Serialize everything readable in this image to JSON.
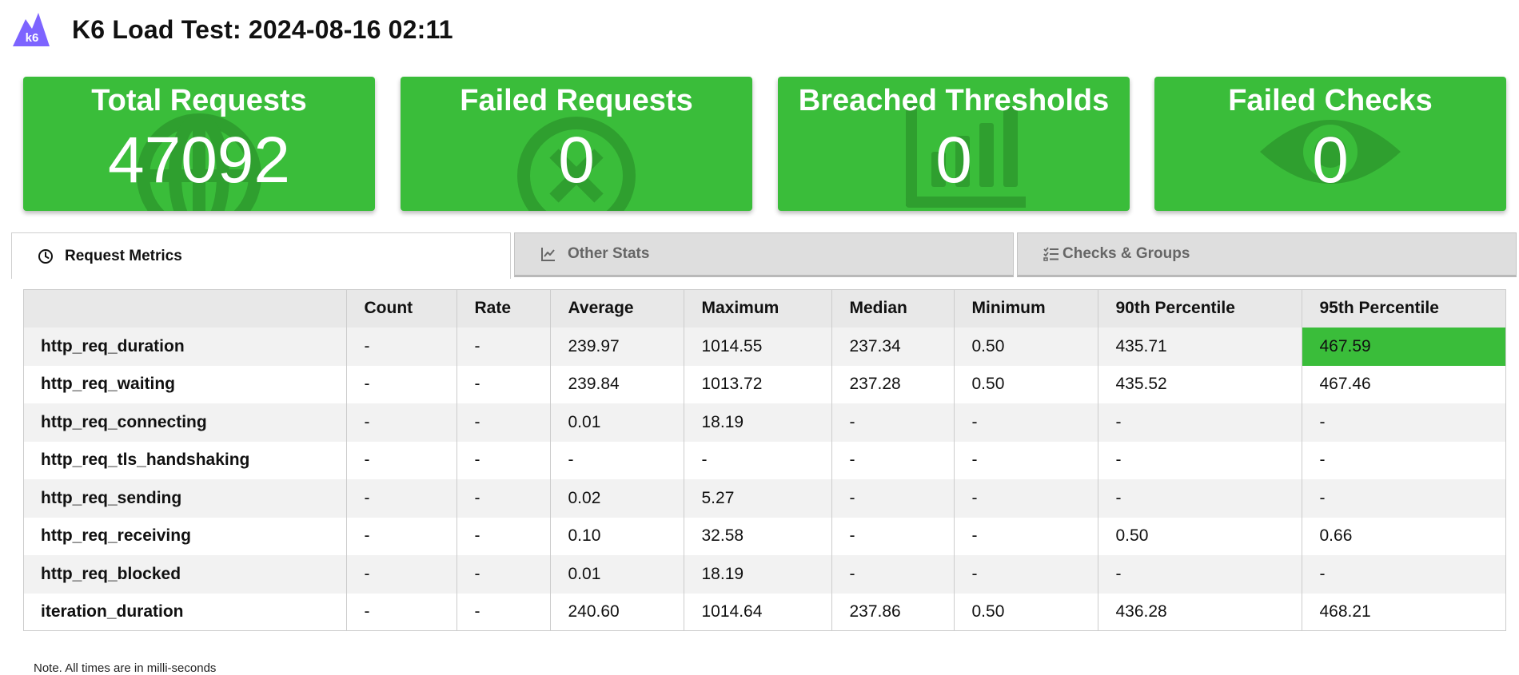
{
  "header": {
    "logo_text": "k6",
    "title": "K6 Load Test: 2024-08-16 02:11"
  },
  "cards": [
    {
      "title": "Total Requests",
      "value": "47092",
      "icon": "globe-icon"
    },
    {
      "title": "Failed Requests",
      "value": "0",
      "icon": "x-circle-icon"
    },
    {
      "title": "Breached Thresholds",
      "value": "0",
      "icon": "bar-chart-icon"
    },
    {
      "title": "Failed Checks",
      "value": "0",
      "icon": "eye-icon"
    }
  ],
  "tabs": [
    {
      "label": "Request Metrics",
      "icon": "clock-icon",
      "active": true
    },
    {
      "label": "Other Stats",
      "icon": "line-chart-icon",
      "active": false
    },
    {
      "label": "Checks & Groups",
      "icon": "checklist-icon",
      "active": false
    }
  ],
  "table": {
    "columns": [
      "",
      "Count",
      "Rate",
      "Average",
      "Maximum",
      "Median",
      "Minimum",
      "90th Percentile",
      "95th Percentile"
    ],
    "rows": [
      [
        "http_req_duration",
        "-",
        "-",
        "239.97",
        "1014.55",
        "237.34",
        "0.50",
        "435.71",
        "467.59"
      ],
      [
        "http_req_waiting",
        "-",
        "-",
        "239.84",
        "1013.72",
        "237.28",
        "0.50",
        "435.52",
        "467.46"
      ],
      [
        "http_req_connecting",
        "-",
        "-",
        "0.01",
        "18.19",
        "-",
        "-",
        "-",
        "-"
      ],
      [
        "http_req_tls_handshaking",
        "-",
        "-",
        "-",
        "-",
        "-",
        "-",
        "-",
        "-"
      ],
      [
        "http_req_sending",
        "-",
        "-",
        "0.02",
        "5.27",
        "-",
        "-",
        "-",
        "-"
      ],
      [
        "http_req_receiving",
        "-",
        "-",
        "0.10",
        "32.58",
        "-",
        "-",
        "0.50",
        "0.66"
      ],
      [
        "http_req_blocked",
        "-",
        "-",
        "0.01",
        "18.19",
        "-",
        "-",
        "-",
        "-"
      ],
      [
        "iteration_duration",
        "-",
        "-",
        "240.60",
        "1014.64",
        "237.86",
        "0.50",
        "436.28",
        "468.21"
      ]
    ]
  },
  "note": "Note. All times are in milli-seconds",
  "colors": {
    "card_green": "#3abd3a",
    "card_icon_dark": "#2f9f2f",
    "logo_purple": "#7d64ff",
    "highlight_green": "#3abd3a"
  }
}
